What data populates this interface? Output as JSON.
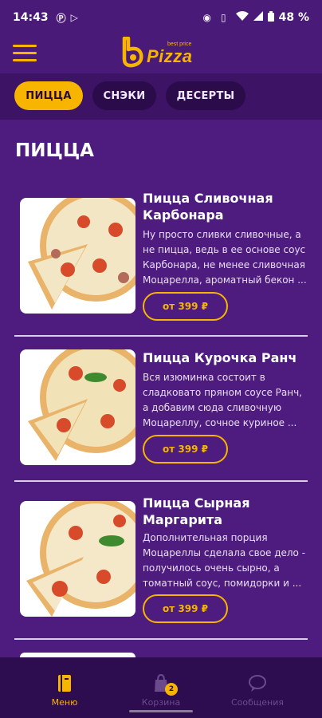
{
  "status_bar": {
    "time": "14:43",
    "battery": "48 %",
    "icons": [
      "p-icon",
      "play-icon",
      "eye-icon",
      "vibrate-icon",
      "wifi-icon",
      "signal-icon",
      "battery-icon"
    ]
  },
  "header": {
    "logo_brand": "Pizza",
    "logo_sub": "best price",
    "menu_icon": "menu-icon"
  },
  "tabs": [
    {
      "label": "ПИЦЦА",
      "active": true
    },
    {
      "label": "СНЭКИ",
      "active": false
    },
    {
      "label": "ДЕСЕРТЫ",
      "active": false
    }
  ],
  "section_title": "ПИЦЦА",
  "products": [
    {
      "name_line1": "Пицца Сливочная",
      "name_line2": "Карбонара",
      "desc_lines": [
        "Ну просто сливки сливочные, а",
        "не пицца, ведь в ее основе соус",
        "Карбонара, не менее сливочная",
        "Моцарелла, ароматный бекон ..."
      ],
      "price": "от 399 ₽"
    },
    {
      "name_line1": "Пицца Курочка Ранч",
      "name_line2": "",
      "desc_lines": [
        "Вся изюминка состоит в",
        "сладковато пряном соусе Ранч,",
        "а добавим сюда сливочную",
        "Моцареллу, сочное куриное ..."
      ],
      "price": "от 399 ₽"
    },
    {
      "name_line1": "Пицца Сырная",
      "name_line2": "Маргарита",
      "desc_lines": [
        "Дополнительная порция",
        "Моцареллы сделала свое дело -",
        "получилось очень сырно, а",
        "томатный соус, помидорки и ..."
      ],
      "price": "от 399 ₽"
    }
  ],
  "bottom_nav": [
    {
      "label": "Меню",
      "icon": "menu-book-icon",
      "active": true
    },
    {
      "label": "Корзина",
      "icon": "cart-icon",
      "active": false,
      "badge": "2"
    },
    {
      "label": "Сообщения",
      "icon": "chat-icon",
      "active": false
    }
  ],
  "colors": {
    "background": "#4e1c7e",
    "accent": "#f7b500",
    "nav_background": "#2e0c50"
  }
}
